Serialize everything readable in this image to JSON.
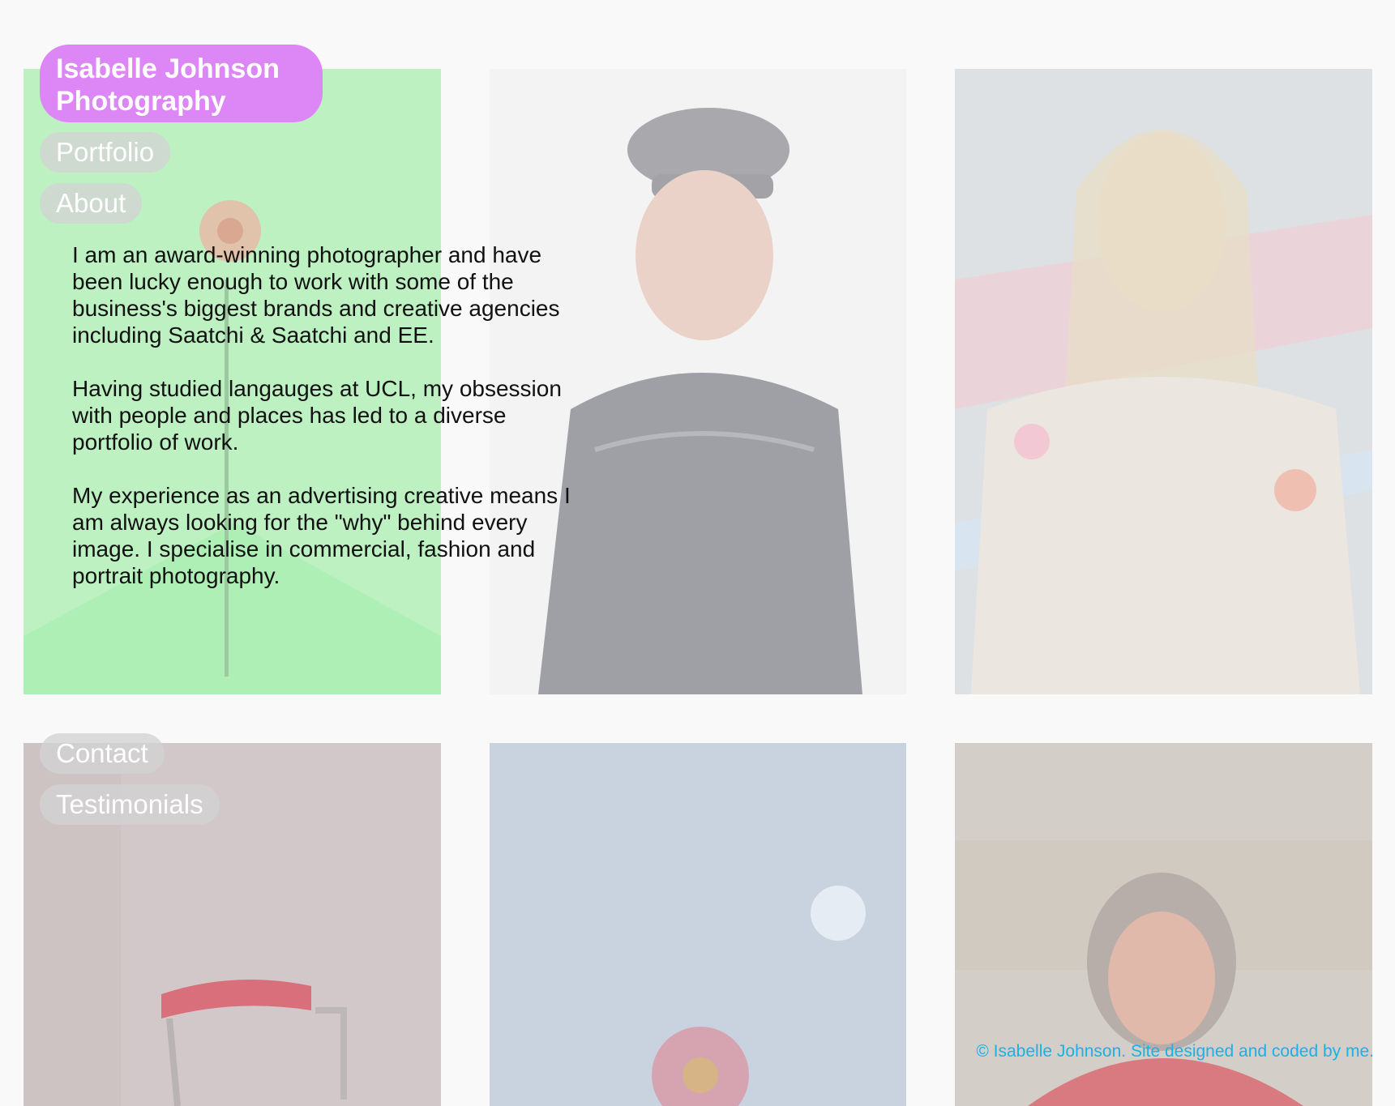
{
  "site": {
    "brand": "Isabelle Johnson Photography"
  },
  "nav": {
    "portfolio": "Portfolio",
    "about": "About",
    "contact": "Contact",
    "testimonials": "Testimonials"
  },
  "about": {
    "paragraphs": [
      "I am an award-winning photographer and have been lucky enough to work with some of the business's biggest brands and creative agencies including Saatchi & Saatchi and EE.",
      "Having studied langauges at UCL, my obsession with people and places has led to a diverse portfolio of work.",
      "My experience as an advertising creative means I am always looking for the \"why\" behind every image. I specialise in commercial, fashion and portrait photography."
    ]
  },
  "gallery": {
    "photos": [
      {
        "id": "green-flower-photo",
        "subject": "flower on green backdrop"
      },
      {
        "id": "man-in-cap-photo",
        "subject": "man in cap"
      },
      {
        "id": "woman-illustrated-photo",
        "subject": "woman with illustrated background"
      },
      {
        "id": "red-chair-photo",
        "subject": "red chair"
      },
      {
        "id": "red-flower-sky-photo",
        "subject": "red flower against sky"
      },
      {
        "id": "smiling-woman-photo",
        "subject": "smiling woman outdoors"
      }
    ]
  },
  "footer": {
    "text": "© Isabelle Johnson. Site designed and coded by me."
  },
  "colors": {
    "brand_pill": "#dd87f6",
    "nav_pill": "#d2d2d2",
    "footer_link": "#1ab0e8",
    "page_background": "#f9f9f9"
  }
}
